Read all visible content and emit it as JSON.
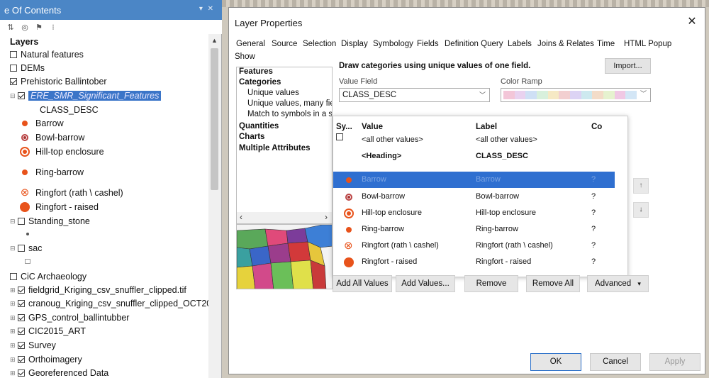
{
  "toc": {
    "title": "e Of Contents",
    "layers_heading": "Layers",
    "items": [
      {
        "label": "Natural features"
      },
      {
        "label": "DEMs"
      },
      {
        "label": "Prehistoric Ballintober"
      },
      {
        "label": "ERE_SMR_Significant_Features"
      },
      {
        "label": "CLASS_DESC"
      },
      {
        "label": "Barrow"
      },
      {
        "label": "Bowl-barrow"
      },
      {
        "label": "Hill-top enclosure"
      },
      {
        "label": "Ring-barrow"
      },
      {
        "label": "Ringfort (rath \\ cashel)"
      },
      {
        "label": "Ringfort - raised"
      },
      {
        "label": "Standing_stone"
      },
      {
        "label": "sac"
      },
      {
        "label": "CiC Archaeology"
      },
      {
        "label": "fieldgrid_Kriging_csv_snuffler_clipped.tif"
      },
      {
        "label": "cranoug_Kriging_csv_snuffler_clipped_OCT20"
      },
      {
        "label": "GPS_control_ballintubber"
      },
      {
        "label": "CIC2015_ART"
      },
      {
        "label": "Survey"
      },
      {
        "label": "Orthoimagery"
      },
      {
        "label": "Georeferenced Data"
      }
    ]
  },
  "dialog": {
    "title": "Layer Properties",
    "close": "✕",
    "tabs": [
      "General",
      "Source",
      "Selection",
      "Display",
      "Symbology",
      "Fields",
      "Definition Query",
      "Labels",
      "Joins & Relates",
      "Time",
      "HTML Popup"
    ],
    "show_label": "Show",
    "categories": {
      "features": "Features",
      "categories": "Categories",
      "unique_values": "Unique values",
      "unique_values_many": "Unique values, many fie",
      "match_to_symbols": "Match to symbols in a st",
      "quantities": "Quantities",
      "charts": "Charts",
      "multiple_attributes": "Multiple Attributes"
    },
    "draw_label": "Draw categories using unique values of one field.",
    "import_button": "Import...",
    "value_field_label": "Value Field",
    "value_field_value": "CLASS_DESC",
    "color_ramp_label": "Color Ramp",
    "color_ramp_colors": [
      "#f3c6d8",
      "#e9d2ef",
      "#cfe0f5",
      "#d8f0dc",
      "#f6e9c4",
      "#f2cfd0",
      "#dcd3f4",
      "#cde9ef",
      "#f3dcc8",
      "#e6f2cf",
      "#f0c8e4",
      "#d3e6f6"
    ],
    "table": {
      "headers": {
        "sym": "Sy...",
        "value": "Value",
        "label": "Label",
        "count": "Co"
      },
      "rows": [
        {
          "value": "<all other values>",
          "label": "<all other values>",
          "count": ""
        },
        {
          "value": "<Heading>",
          "label": "CLASS_DESC",
          "count": ""
        },
        {
          "value": "Barrow",
          "label": "Barrow",
          "count": "?"
        },
        {
          "value": "Bowl-barrow",
          "label": "Bowl-barrow",
          "count": "?"
        },
        {
          "value": "Hill-top enclosure",
          "label": "Hill-top enclosure",
          "count": "?"
        },
        {
          "value": "Ring-barrow",
          "label": "Ring-barrow",
          "count": "?"
        },
        {
          "value": "Ringfort (rath \\ cashel)",
          "label": "Ringfort (rath \\ cashel)",
          "count": "?"
        },
        {
          "value": "Ringfort - raised",
          "label": "Ringfort - raised",
          "count": "?"
        }
      ]
    },
    "buttons": {
      "add_all": "Add All Values",
      "add_values": "Add Values...",
      "remove": "Remove",
      "remove_all": "Remove All",
      "advanced": "Advanced",
      "ok": "OK",
      "cancel": "Cancel",
      "apply": "Apply"
    },
    "side_buttons": {
      "up": "↑",
      "down": "↓"
    }
  },
  "colors": {
    "toc_header": "#4b86c6",
    "selection": "#2f6fd0",
    "symbol": "#e8531b"
  }
}
